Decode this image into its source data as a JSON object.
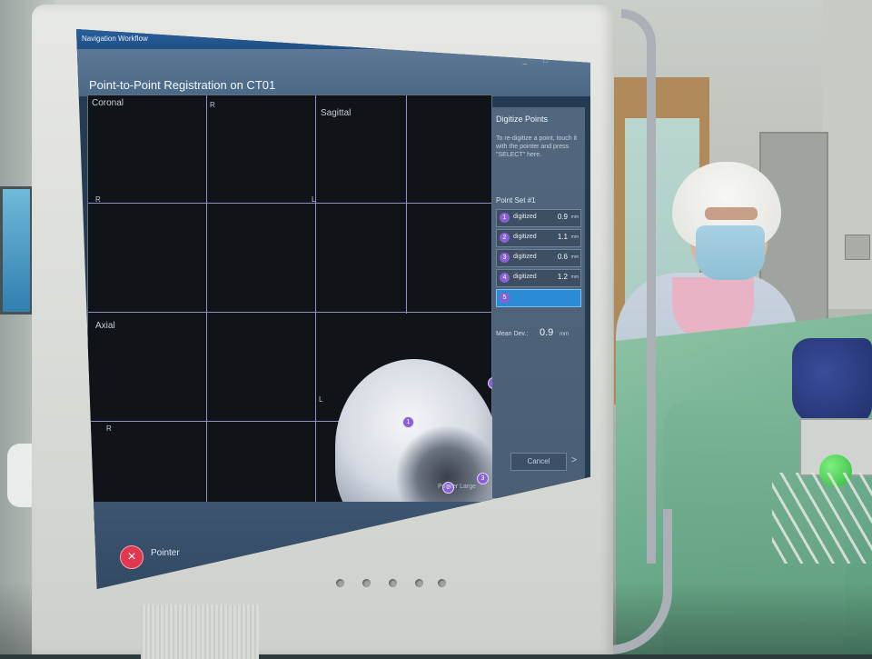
{
  "window": {
    "title": "Navigation Workflow",
    "controls": "_ □ ×"
  },
  "app": {
    "title": "Point-to-Point Registration on CT01"
  },
  "viewports": {
    "coronal_label": "Coronal",
    "sagittal_label": "Sagittal",
    "axial_label": "Axial",
    "orient_r": "R",
    "orient_l": "L"
  },
  "panel": {
    "title": "Digitize Points",
    "help": "To re-digitize a point, touch it with the pointer and press \"SELECT\" here.",
    "point_set_label": "Point Set #1",
    "points": [
      {
        "num": "1",
        "status": "digitized",
        "value": "0.9",
        "unit": "mm"
      },
      {
        "num": "2",
        "status": "digitized",
        "value": "1.1",
        "unit": "mm"
      },
      {
        "num": "3",
        "status": "digitized",
        "value": "0.6",
        "unit": "mm"
      },
      {
        "num": "4",
        "status": "digitized",
        "value": "1.2",
        "unit": "mm"
      },
      {
        "num": "5",
        "status": "",
        "value": "",
        "unit": ""
      }
    ],
    "mean_label": "Mean Dev.:",
    "mean_value": "0.9",
    "mean_unit": "mm"
  },
  "footer": {
    "pointer_label": "Pointer",
    "status_text": "Pointer Large",
    "cancel_label": "Cancel",
    "next_icon": ">"
  },
  "colors": {
    "marker": "#8b5fd6",
    "selected_row": "#2d8bd6",
    "pointer_icon": "#e0384f"
  }
}
